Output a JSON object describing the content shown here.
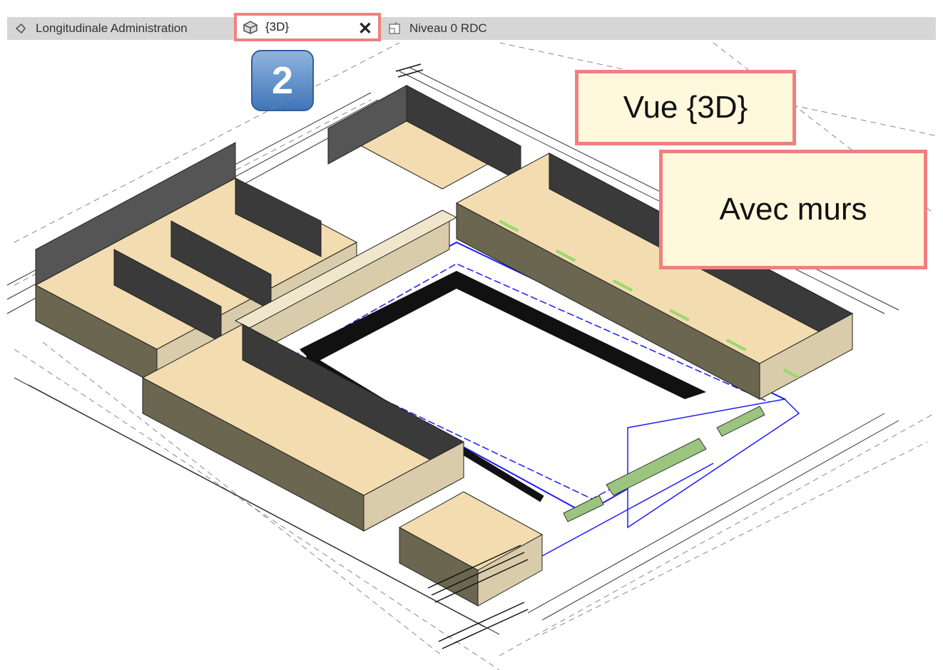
{
  "tabs": [
    {
      "label": "Longitudinale Administration",
      "icon": "elevation-view-icon",
      "active": false
    },
    {
      "label": "{3D}",
      "icon": "3d-view-icon",
      "active": true
    },
    {
      "label": "Niveau 0 RDC",
      "icon": "floor-plan-icon",
      "active": false
    }
  ],
  "step_badge": "2",
  "callouts": {
    "view": "Vue {3D}",
    "walls": "Avec murs"
  },
  "colors": {
    "callout_border": "#f08080",
    "callout_fill": "#fff8dc",
    "wall_top": "#d9ccaa",
    "wall_side": "#6b6650",
    "floor": "#f2dcb0",
    "courtyard_outline": "#1a1aff"
  }
}
